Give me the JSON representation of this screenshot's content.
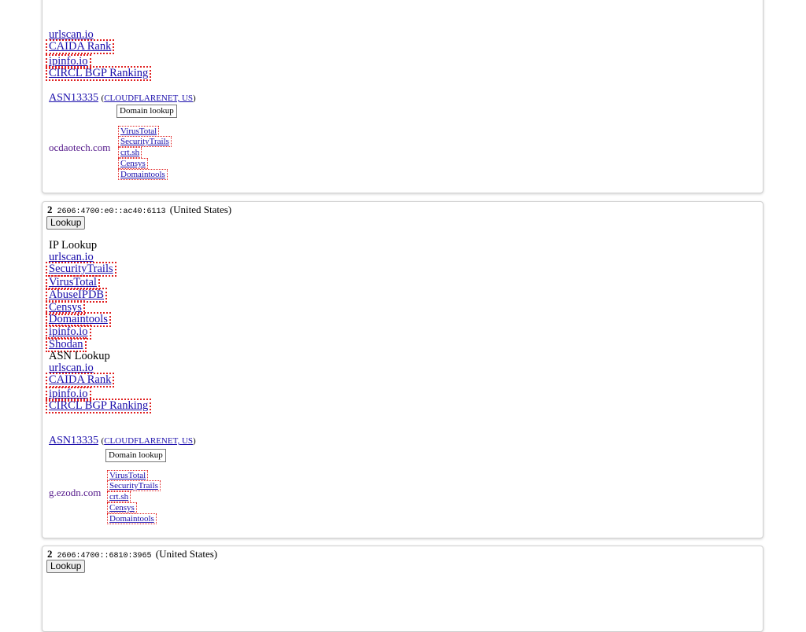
{
  "card1": {
    "asn_links": [
      "urlscan.io",
      "CAIDA Rank",
      "ipinfo.io",
      "CIRCL BGP Ranking"
    ],
    "asn": "ASN13335",
    "org": "CLOUDFLARENET, US",
    "domain_lookup_label": "Domain lookup",
    "domain": "ocdaotech.com",
    "domain_links": [
      "VirusTotal",
      "SecurityTrails",
      "crt.sh",
      "Censys",
      "Domaintools"
    ]
  },
  "card2": {
    "num": "2",
    "ip": "2606:4700:e0::ac40:6113",
    "country": "(United States)",
    "lookup_label": "Lookup",
    "ip_lookup_title": "IP Lookup",
    "ip_links": [
      "urlscan.io",
      "SecurityTrails",
      "VirusTotal",
      "AbuseIPDB",
      "Censys",
      "Domaintools",
      "ipinfo.io",
      "Shodan"
    ],
    "asn_lookup_title": "ASN Lookup",
    "asn_links": [
      "urlscan.io",
      "CAIDA Rank",
      "ipinfo.io",
      "CIRCL BGP Ranking"
    ],
    "asn": "ASN13335",
    "org": "CLOUDFLARENET, US",
    "domain_lookup_label": "Domain lookup",
    "domain": "g.ezodn.com",
    "domain_links": [
      "VirusTotal",
      "SecurityTrails",
      "crt.sh",
      "Censys",
      "Domaintools"
    ]
  },
  "card3": {
    "num": "2",
    "ip": "2606:4700::6810:3965",
    "country": "(United States)",
    "lookup_label": "Lookup"
  }
}
